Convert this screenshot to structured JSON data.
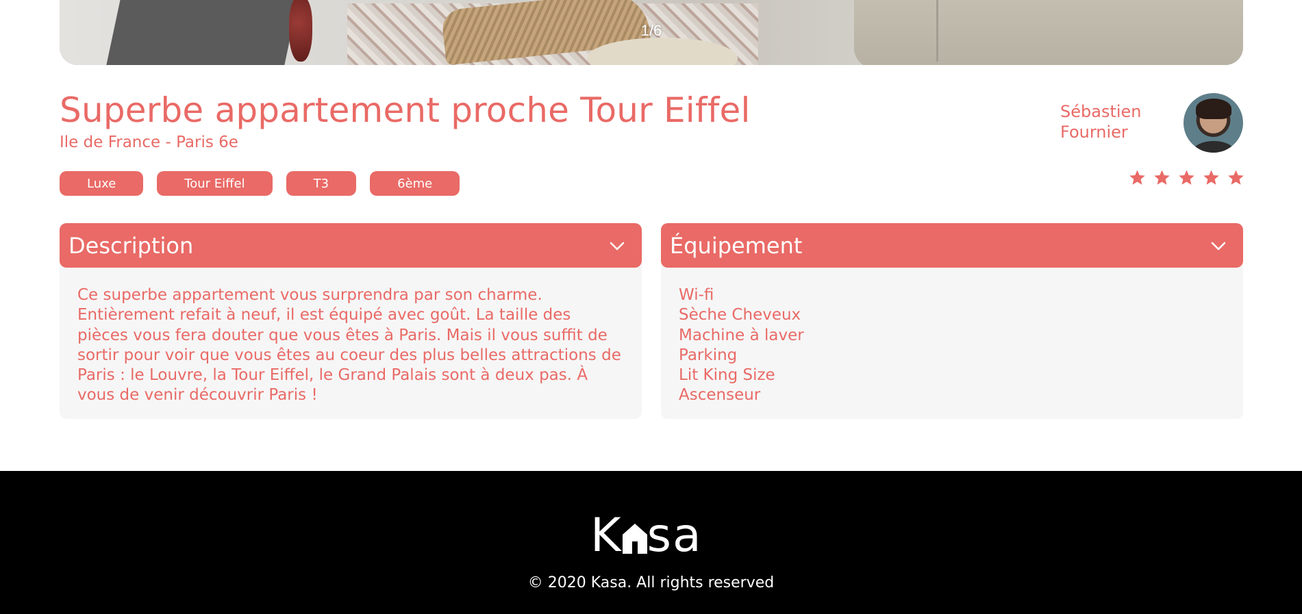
{
  "gallery": {
    "counter": "1/6"
  },
  "listing": {
    "title": "Superbe appartement proche Tour Eiffel",
    "location": "Ile de France - Paris 6e",
    "tags": [
      "Luxe",
      "Tour Eiffel",
      "T3",
      "6ème"
    ],
    "rating": 5,
    "rating_max": 5
  },
  "host": {
    "first_name": "Sébastien",
    "last_name": "Fournier"
  },
  "description": {
    "title": "Description",
    "text": "Ce superbe appartement vous surprendra par son charme. Entièrement refait à neuf, il est équipé avec goût. La taille des pièces vous fera douter que vous êtes à Paris. Mais il vous suffit de sortir pour voir que vous êtes au coeur des plus belles attractions de Paris : le Louvre, la Tour Eiffel, le Grand Palais sont à deux pas. À vous de venir découvrir Paris !"
  },
  "equipment": {
    "title": "Équipement",
    "items": [
      "Wi-fi",
      "Sèche Cheveux",
      "Machine à laver",
      "Parking",
      "Lit King Size",
      "Ascenseur"
    ]
  },
  "footer": {
    "logo_left": "K",
    "logo_right": "sa",
    "copyright": "© 2020 Kasa. All rights reserved"
  },
  "colors": {
    "accent": "#E96A66",
    "panel": "#F6F6F6",
    "footer_bg": "#000000"
  },
  "icons": {
    "collapse_toggle": "chevron-down-icon",
    "rating": "star-icon",
    "logo_house": "house-icon"
  }
}
